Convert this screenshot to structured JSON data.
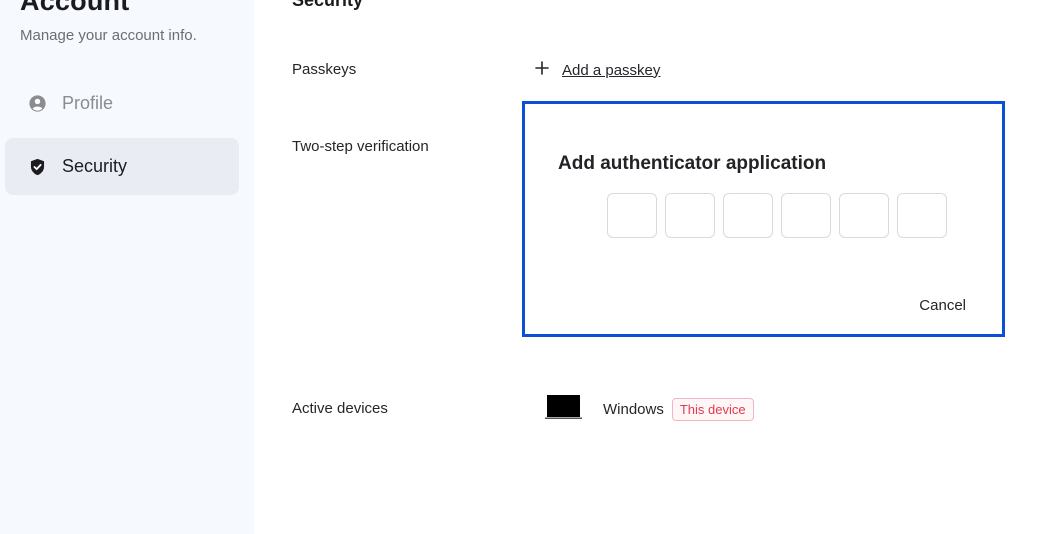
{
  "sidebar": {
    "title": "Account",
    "subtitle": "Manage your account info.",
    "items": [
      {
        "label": "Profile",
        "icon": "user-circle-icon",
        "active": false
      },
      {
        "label": "Security",
        "icon": "shield-check-icon",
        "active": true
      }
    ]
  },
  "main": {
    "heading": "Security",
    "passkeys": {
      "label": "Passkeys",
      "add_label": "Add a passkey"
    },
    "two_step": {
      "label": "Two-step verification",
      "card_title": "Add authenticator application",
      "code_digits": [
        "",
        "",
        "",
        "",
        "",
        ""
      ],
      "cancel_label": "Cancel"
    },
    "devices": {
      "label": "Active devices",
      "device_name": "Windows",
      "badge": "This device"
    }
  },
  "colors": {
    "accent_border": "#0b4fd8",
    "badge_text": "#e23a4d",
    "sidebar_bg": "#f6f9fd"
  }
}
